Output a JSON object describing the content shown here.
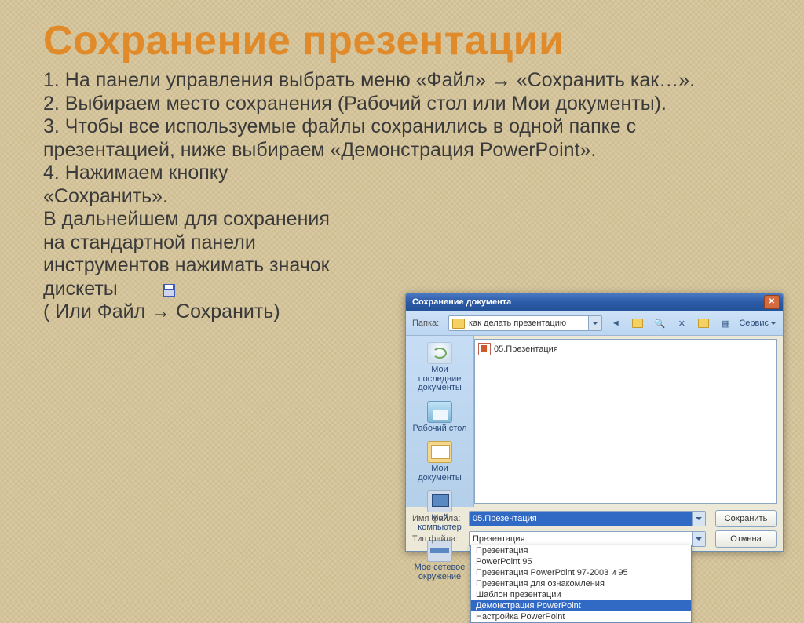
{
  "title": "Сохранение презентации",
  "steps": {
    "s1": "1. На панели управления выбрать меню «Файл» → «Сохранить как…».",
    "s2": "2. Выбираем место сохранения (Рабочий стол или Мои документы).",
    "s3": "3. Чтобы все используемые файлы сохранились в одной папке с презентацией, ниже выбираем «Демонстрация PowerPoint».",
    "s4a": "4. Нажимаем кнопку",
    "s4b": "«Сохранить».",
    "note1": " В дальнейшем для сохранения",
    "note2": "на стандартной панели",
    "note3": "инструментов нажимать значок",
    "note4": "дискеты",
    "note5": "( Или Файл → Сохранить)"
  },
  "dialog": {
    "title": "Сохранение документа",
    "folder_label": "Папка:",
    "folder_value": "как делать презентацию",
    "service_label": "Сервис",
    "places": {
      "recent": "Мои последние документы",
      "desktop": "Рабочий стол",
      "docs": "Мои документы",
      "computer": "Мой компьютер",
      "network": "Мое сетевое окружение"
    },
    "file_in_list": "05.Презентация",
    "filename_label": "Имя файла:",
    "filename_value": "05.Презентация",
    "filetype_label": "Тип файла:",
    "filetype_value": "Презентация",
    "save_btn": "Сохранить",
    "cancel_btn": "Отмена",
    "type_options": [
      "Презентация",
      "PowerPoint 95",
      "Презентация PowerPoint 97-2003 и 95",
      "Презентация для ознакомления",
      "Шаблон презентации",
      "Демонстрация PowerPoint",
      "Настройка PowerPoint"
    ],
    "type_selected_index": 5
  }
}
